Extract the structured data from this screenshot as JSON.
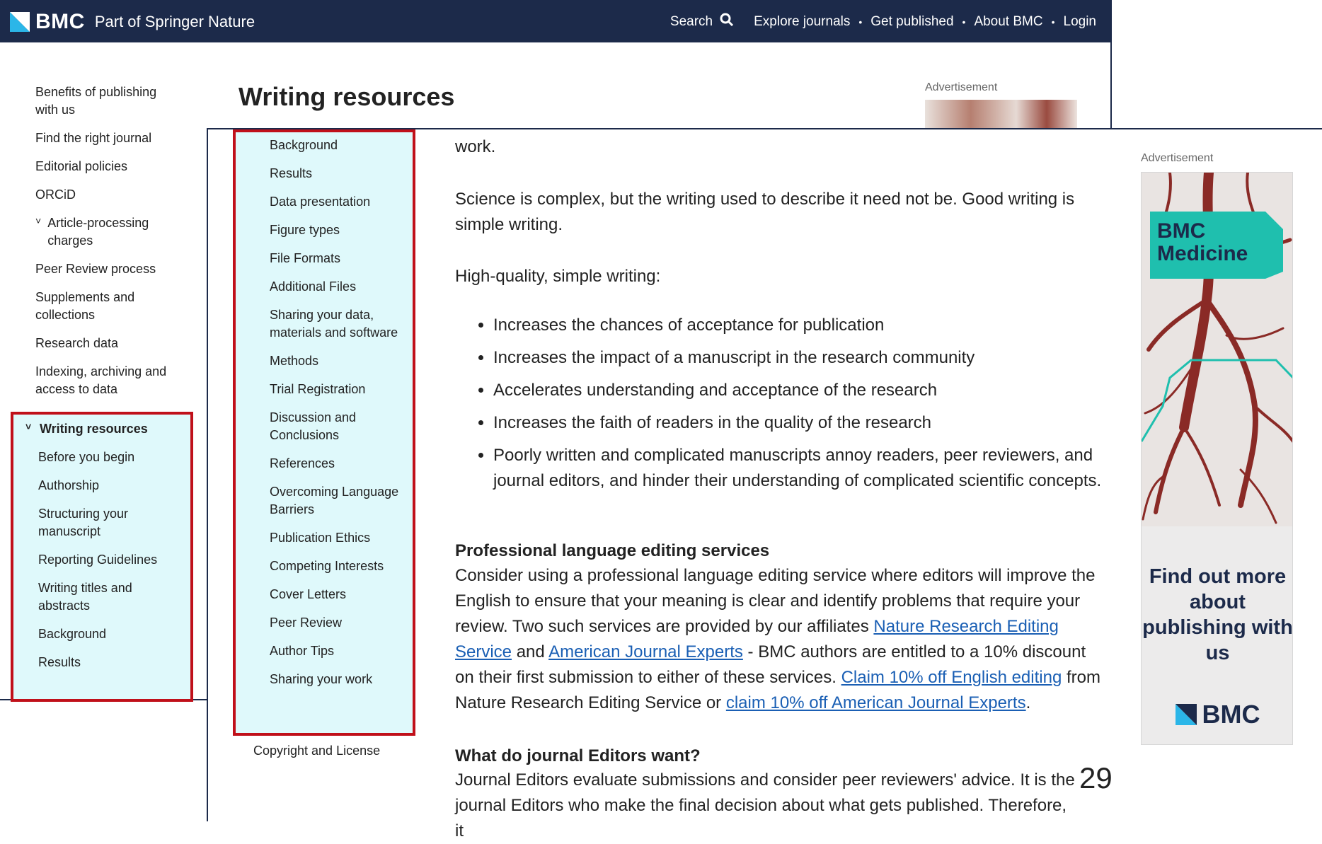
{
  "header": {
    "brand": "BMC",
    "tagline": "Part of Springer Nature",
    "nav": [
      "Search",
      "Explore journals",
      "Get published",
      "About BMC",
      "Login"
    ]
  },
  "back_page": {
    "title": "Writing resources",
    "advertisement_label": "Advertisement",
    "sidebar": [
      "Benefits of publishing with us",
      "Find the right journal",
      "Editorial policies",
      "ORCiD",
      "Article-processing charges",
      "Peer Review process",
      "Supplements and collections",
      "Research data",
      "Indexing, archiving and access to data"
    ],
    "highlight": {
      "heading": "Writing resources",
      "items": [
        "Before you begin",
        "Authorship",
        "Structuring your manuscript",
        "Reporting Guidelines",
        "Writing titles and abstracts",
        "Background",
        "Results"
      ]
    }
  },
  "front_page": {
    "sidebar_items": [
      "Background",
      "Results",
      "Data presentation",
      "Figure types",
      "File Formats",
      "Additional Files",
      "Sharing your data, materials and software",
      "Methods",
      "Trial Registration",
      "Discussion and Conclusions",
      "References",
      "Overcoming Language Barriers",
      "Publication Ethics",
      "Competing Interests",
      "Cover Letters",
      "Peer Review",
      "Author Tips",
      "Sharing your work"
    ],
    "sidebar_after": "Copyright and License",
    "content": {
      "fragment": "work.",
      "p1": "Science is complex, but the writing used to describe it need not be. Good writing is simple writing.",
      "p2": "High-quality, simple writing:",
      "bullets": [
        "Increases the chances of acceptance for publication",
        "Increases the impact of a manuscript in the research community",
        "Accelerates understanding and acceptance of the research",
        "Increases the faith of readers in the quality of the research",
        "Poorly written and complicated manuscripts annoy readers, peer reviewers, and journal editors, and hinder their understanding of complicated scientific concepts."
      ],
      "h_services": "Professional language editing services",
      "p_services_1": "Consider using a professional language editing service where editors will improve the English to ensure that your meaning is clear and identify problems that require your review. Two such services are provided by our affiliates ",
      "link_nres": "Nature Research Editing Service",
      "p_services_and": " and ",
      "link_aje": "American Journal Experts",
      "p_services_2": " - BMC authors are entitled to a 10% discount on their first submission to either of these services. ",
      "link_claim1": "Claim 10% off English editing",
      "p_services_3": " from Nature Research Editing Service or ",
      "link_claim2": "claim 10% off American Journal Experts",
      "p_services_end": ".",
      "h_editors": "What do journal Editors want?",
      "p_editors": "Journal Editors evaluate submissions and consider peer reviewers' advice. It is the journal Editors who make the final decision about what gets published. Therefore, it"
    },
    "ad": {
      "label": "Advertisement",
      "badge": "BMC Medicine",
      "text": "Find out more about publishing with us",
      "logo": "BMC"
    }
  },
  "slide_number": "29",
  "colors": {
    "header_bg": "#1c2a4a",
    "highlight_border": "#c0101a",
    "highlight_bg": "#dff9fb",
    "link": "#1a5fb4",
    "ad_teal": "#1fbfae"
  }
}
